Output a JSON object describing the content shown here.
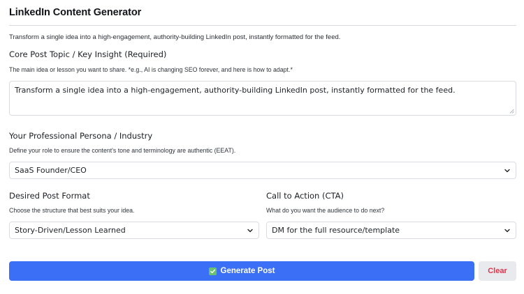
{
  "app": {
    "title": "LinkedIn Content Generator",
    "subtitle": "Transform a single idea into a high-engagement, authority-building LinkedIn post, instantly formatted for the feed."
  },
  "topic": {
    "label": "Core Post Topic / Key Insight (Required)",
    "help": "The main idea or lesson you want to share. *e.g., AI is changing SEO forever, and here is how to adapt.*",
    "value": "Transform a single idea into a high-engagement, authority-building LinkedIn post, instantly formatted for the feed."
  },
  "persona": {
    "label": "Your Professional Persona / Industry",
    "help": "Define your role to ensure the content's tone and terminology are authentic (EEAT).",
    "selected": "SaaS Founder/CEO"
  },
  "format": {
    "label": "Desired Post Format",
    "help": "Choose the structure that best suits your idea.",
    "selected": "Story-Driven/Lesson Learned"
  },
  "cta": {
    "label": "Call to Action (CTA)",
    "help": "What do you want the audience to do next?",
    "selected": "DM for the full resource/template"
  },
  "actions": {
    "generate_label": "Generate Post",
    "clear_label": "Clear"
  },
  "colors": {
    "primary": "#3b6ff5",
    "clear_text": "#e0344b",
    "check": "#6cc26c"
  },
  "icons": {
    "select_arrow": "chevron-down-icon",
    "generate": "check-icon"
  }
}
